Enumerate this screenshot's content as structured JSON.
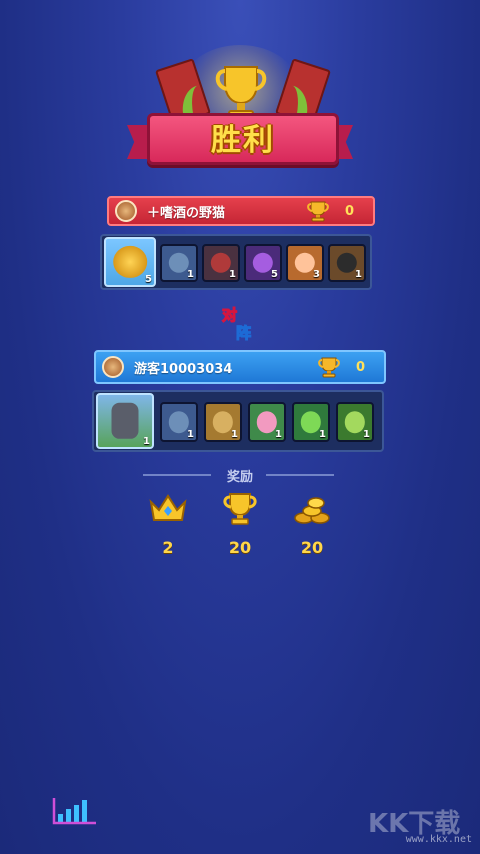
{
  "result": {
    "title": "胜利"
  },
  "vs_label": "对阵",
  "player1": {
    "name": "＋嗜酒の野猫",
    "trophies": "0",
    "hero_level": "5",
    "card_levels": [
      "1",
      "1",
      "5",
      "3",
      "1"
    ]
  },
  "player2": {
    "name": "游客10003034",
    "trophies": "0",
    "hero_level": "1",
    "card_levels": [
      "1",
      "1",
      "1",
      "1",
      "1"
    ]
  },
  "rewards": {
    "title": "奖励",
    "items": [
      {
        "icon": "crown-icon",
        "value": "2"
      },
      {
        "icon": "trophy-icon",
        "value": "20"
      },
      {
        "icon": "gold-coins-icon",
        "value": "20"
      }
    ]
  },
  "watermark": {
    "text": "www.kkx.net"
  },
  "colors": {
    "background": "#1f2f86",
    "player1_bar": "#d8303f",
    "player2_bar": "#2a8ae4",
    "gold": "#ffd64a"
  }
}
